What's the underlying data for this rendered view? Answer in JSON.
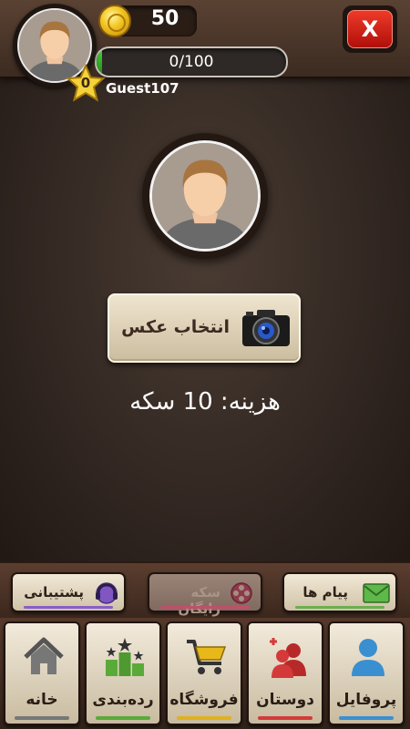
{
  "header": {
    "coins": "50",
    "xp_text": "0/100",
    "xp_progress": 0.03,
    "level": "0",
    "username": "Guest107",
    "close_label": "X"
  },
  "main": {
    "choose_photo_label": "انتخاب عکس",
    "cost_text": "هزینه: 10 سکه"
  },
  "mid_bar": {
    "messages": {
      "label": "پیام ها",
      "icon": "envelope-icon",
      "accent": "#6ab04c"
    },
    "free_coins": {
      "label": "سکه رایگان",
      "icon": "film-reel-icon",
      "accent": "#c0506a",
      "disabled": true
    },
    "support": {
      "label": "پشتیبانی",
      "icon": "headset-icon",
      "accent": "#8a5cc8"
    }
  },
  "nav": {
    "profile": {
      "label": "پروفایل",
      "icon": "user-icon",
      "accent": "#3a8fd0"
    },
    "friends": {
      "label": "دوستان",
      "icon": "friends-icon",
      "accent": "#d43a3a"
    },
    "shop": {
      "label": "فروشگاه",
      "icon": "cart-icon",
      "accent": "#e0b020"
    },
    "ranking": {
      "label": "رده‌بندی",
      "icon": "podium-icon",
      "accent": "#5aaa3a"
    },
    "home": {
      "label": "خانه",
      "icon": "home-icon",
      "accent": "#777777"
    }
  }
}
